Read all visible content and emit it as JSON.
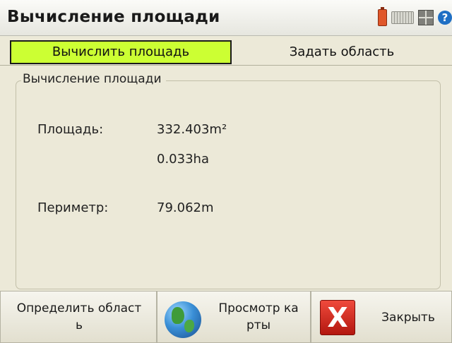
{
  "app": {
    "title": "Вычисление площади"
  },
  "tray": {
    "icons": [
      "battery-icon",
      "keyboard-icon",
      "grid-icon",
      "help-icon"
    ],
    "help_glyph": "?"
  },
  "tabs": [
    {
      "label": "Вычислить площадь",
      "active": true
    },
    {
      "label": "Задать область",
      "active": false
    }
  ],
  "panel": {
    "legend": "Вычисление площади",
    "area_label": "Площадь:",
    "area_m2": "332.403m²",
    "area_ha": "0.033ha",
    "perimeter_label": "Периметр:",
    "perimeter_value": "79.062m"
  },
  "buttons": {
    "define_area": {
      "line1": "Определить област",
      "line2": "ь"
    },
    "map_view": {
      "line1": "Просмотр ка",
      "line2": "рты"
    },
    "close": {
      "label": "Закрыть",
      "glyph": "X"
    }
  },
  "colors": {
    "active_tab": "#ccff33",
    "background": "#ece9d8",
    "close_red": "#d9261c"
  }
}
